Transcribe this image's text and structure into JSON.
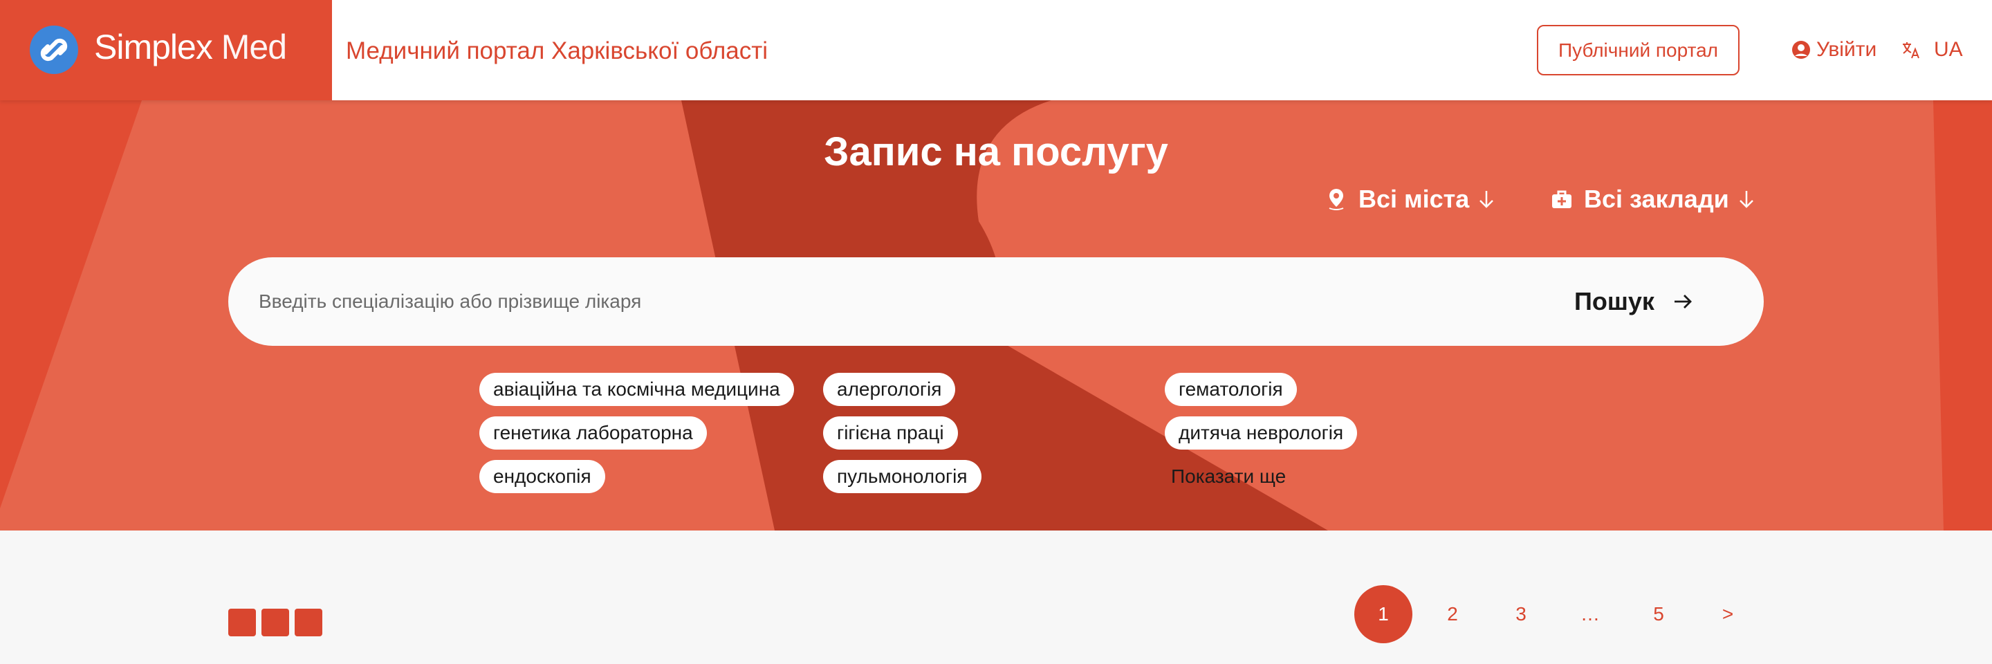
{
  "header": {
    "logo_text_a": "Simplex",
    "logo_text_b": "Med",
    "portal_title": "Медичний портал Харківської області",
    "public_portal_label": "Публічний портал",
    "login_label": "Увійти",
    "lang_label": "UA"
  },
  "hero": {
    "title": "Запис на послугу",
    "city_filter": "Всі міста",
    "institution_filter": "Всі заклади",
    "search_placeholder": "Введіть спеціалізацію або прізвище лікаря",
    "search_button": "Пошук",
    "chips": [
      "авіаційна та космічна медицина",
      "алергологія",
      "гематологія",
      "генетика лабораторна",
      "гігієна праці",
      "дитяча неврологія",
      "ендоскопія",
      "пульмонологія"
    ],
    "show_more": "Показати ще"
  },
  "pagination": {
    "pages": [
      "1",
      "2",
      "3",
      "…",
      "5",
      ">"
    ],
    "current": "1"
  },
  "colors": {
    "brand": "#d9462f",
    "hero_bg": "#e6654c",
    "hero_dark": "#b93a25",
    "logo_bg": "#e14c33",
    "logo_circle": "#3d86d9"
  }
}
